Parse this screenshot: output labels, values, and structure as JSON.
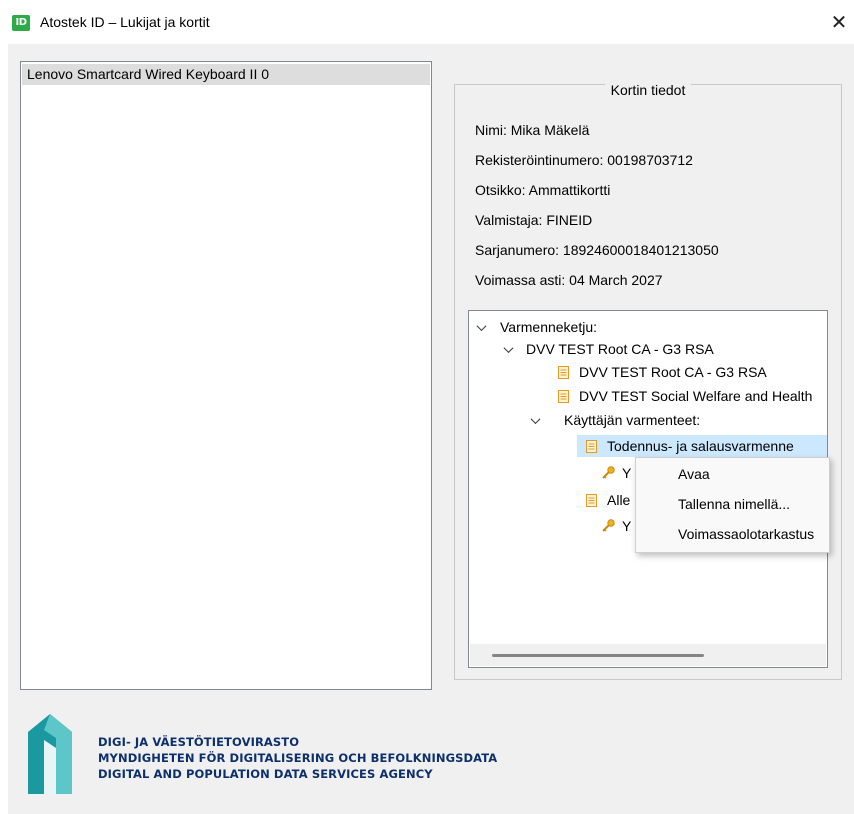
{
  "window": {
    "app_icon_text": "ID",
    "title": "Atostek ID – Lukijat ja kortit",
    "close_glyph": "✕"
  },
  "readers": {
    "items": [
      "Lenovo Smartcard Wired Keyboard II 0"
    ]
  },
  "card_info": {
    "legend": "Kortin tiedot",
    "name": "Nimi: Mika Mäkelä",
    "registration_number": "Rekisteröintinumero: 00198703712",
    "title": "Otsikko: Ammattikortti",
    "manufacturer": "Valmistaja: FINEID",
    "serial_number": "Sarjanumero: 1892460001840121305​0",
    "valid_until": "Voimassa asti: 04 March 2027"
  },
  "tree": {
    "root": "Varmenneketju:",
    "ca_node": "DVV TEST Root CA - G3 RSA",
    "ca_cert_1": "DVV TEST Root CA - G3 RSA",
    "ca_cert_2": "DVV TEST Social Welfare and Health",
    "user_certs_node": "Käyttäjän varmenteet:",
    "auth_cert": "Todennus- ja salausvarmenne",
    "auth_key": "Y",
    "sign_cert": "Alle",
    "sign_key": "Y"
  },
  "context_menu": {
    "items": [
      "Avaa",
      "Tallenna nimellä...",
      "Voimassaolotarkastus"
    ]
  },
  "agency": {
    "line_fi": "DIGI- JA VÄESTÖTIETOVIRASTO",
    "line_sv": "MYNDIGHETEN FÖR DIGITALISERING OCH BEFOLKNINGSDATA",
    "line_en": "DIGITAL AND POPULATION DATA SERVICES AGENCY"
  },
  "colors": {
    "app_icon": "#2eaa4a",
    "selection": "#cce8ff",
    "cert_icon": "#f0a030",
    "key_icon": "#f0b020",
    "logo_teal": "#1a9aa0",
    "agency_text": "#0d2f6b"
  },
  "icons": {
    "app": "id-badge-icon",
    "close": "close-icon",
    "tree_expand": "chevron-down-icon",
    "certificate": "certificate-icon",
    "key": "key-icon",
    "logo": "dvv-logo-icon"
  }
}
